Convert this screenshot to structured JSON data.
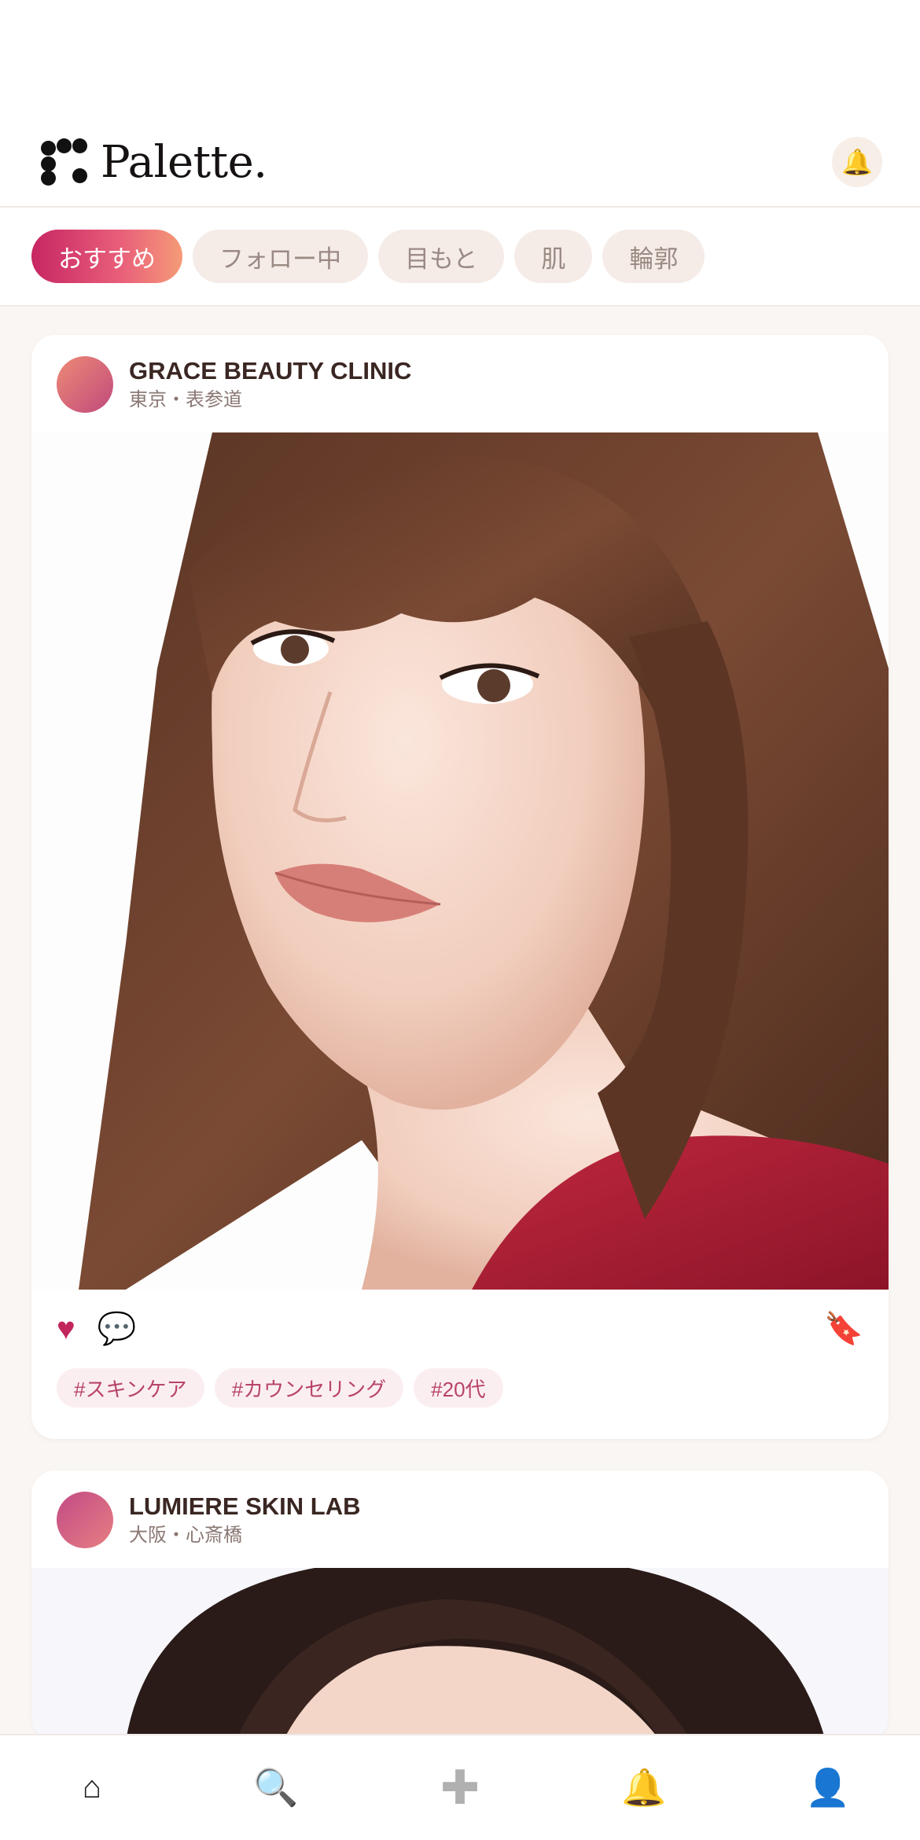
{
  "app": {
    "logo_text": "Palette."
  },
  "header": {
    "bell_icon": "bell-icon"
  },
  "chips": [
    {
      "label": "おすすめ",
      "active": true
    },
    {
      "label": "フォロー中",
      "active": false
    },
    {
      "label": "目もと",
      "active": false
    },
    {
      "label": "肌",
      "active": false
    },
    {
      "label": "輪郭",
      "active": false
    }
  ],
  "posts": [
    {
      "clinic_name": "GRACE BEAUTY CLINIC",
      "location": "東京・表参道",
      "tags": [
        "#スキンケア",
        "#カウンセリング",
        "#20代"
      ]
    },
    {
      "clinic_name": "LUMIERE SKIN LAB",
      "location": "大阪・心斎橋"
    }
  ],
  "icons": {
    "like": "♥",
    "comment": "💬",
    "bookmark": "🔖",
    "bell": "🔔"
  },
  "bottom_nav": {
    "home": "⌂",
    "search": "🔍",
    "add": "✚",
    "notifications": "🔔",
    "profile": "👤"
  },
  "colors": {
    "accent": "#c72663",
    "accent_gradient_end": "#f59b78",
    "chip_bg": "#f5ece7",
    "tag_bg": "#fbeef1",
    "tag_text": "#b8446a"
  }
}
